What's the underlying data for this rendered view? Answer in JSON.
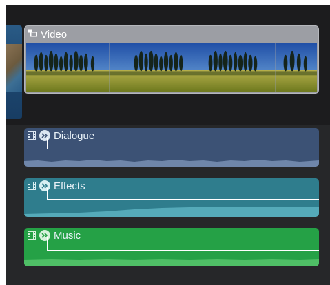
{
  "video_clip": {
    "label": "Video",
    "icon": "connected-clip-icon",
    "color": "#9c9ea4"
  },
  "audio_clips": [
    {
      "label": "Dialogue",
      "role": "dialogue",
      "color": "#3c5275",
      "wave_color": "#6f86aa"
    },
    {
      "label": "Effects",
      "role": "effects",
      "color": "#2f7d8d",
      "wave_color": "#55aab9"
    },
    {
      "label": "Music",
      "role": "music",
      "color": "#25a146",
      "wave_color": "#4fbf66"
    }
  ]
}
